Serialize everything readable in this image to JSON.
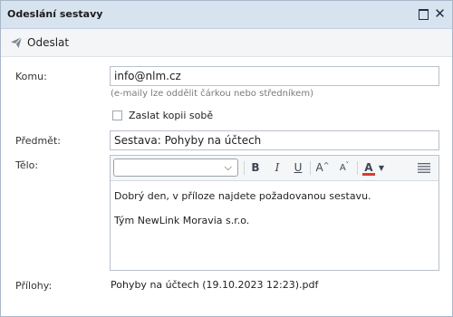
{
  "window": {
    "title": "Odeslání sestavy"
  },
  "toolbar": {
    "send_label": "Odeslat",
    "send_icon": "paper-plane-icon"
  },
  "form": {
    "to_label": "Komu:",
    "to_value": "info@nlm.cz",
    "to_hint": "(e-maily lze oddělit čárkou nebo středníkem)",
    "copy_label": "Zaslat kopii sobě",
    "copy_checked": false,
    "subject_label": "Předmět:",
    "subject_value": "Sestava: Pohyby na účtech",
    "body_label": "Tělo:",
    "body_lines": [
      "Dobrý den, v příloze najdete požadovanou sestavu.",
      "Tým NewLink Moravia s.r.o."
    ],
    "attachments_label": "Přílohy:",
    "attachment_name": "Pohyby na účtech (19.10.2023 12:23).pdf"
  },
  "editor_toolbar": {
    "font_value": "",
    "bold": "B",
    "italic": "I",
    "underline": "U",
    "increase_font": "A",
    "decrease_font": "A",
    "font_color": "A",
    "font_color_hex": "#d83b2f",
    "align_icon": "align-justify-icon"
  },
  "colors": {
    "titlebar": "#d8e3f0",
    "border": "#a9b7c9"
  }
}
